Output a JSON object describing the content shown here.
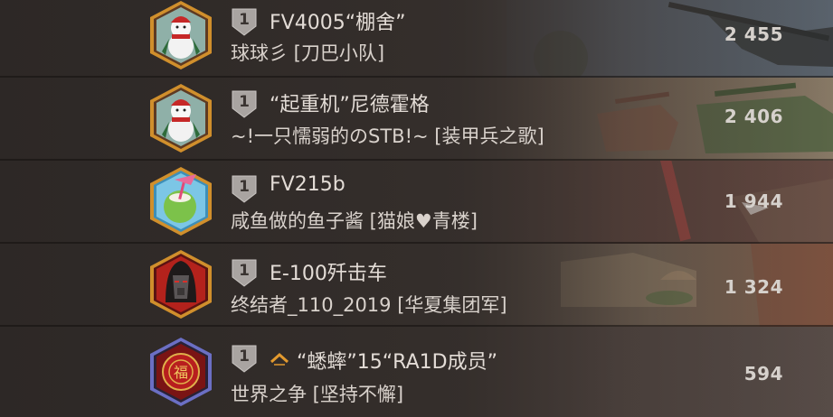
{
  "leaderboard": {
    "rows": [
      {
        "rank": "1",
        "name": "FV4005“棚舍”",
        "clan": "球球彡 [刀巴小队]",
        "score": "2 455",
        "avatar_icon": "snowman-avatar-icon",
        "accent": "#c98a2b"
      },
      {
        "rank": "1",
        "name": "“起重机”尼德霍格",
        "clan": "~!一只懦弱的のSTB!~ [装甲兵之歌]",
        "score": "2 406",
        "avatar_icon": "snowman-avatar-icon",
        "accent": "#c98a2b"
      },
      {
        "rank": "1",
        "name": "FV215b",
        "clan": "咸鱼做的鱼子酱 [猫娘♥青楼]",
        "score": "1 944",
        "avatar_icon": "coconut-drink-avatar-icon",
        "accent": "#c98a2b"
      },
      {
        "rank": "1",
        "name": "E-100歼击车",
        "clan": "终结者_110_2019 [华夏集团军]",
        "score": "1 324",
        "avatar_icon": "hooded-knight-avatar-icon",
        "accent": "#c98a2b"
      },
      {
        "rank": "1",
        "name": "“蟋蟀”15“RA1D成员”",
        "clan": "世界之争 [坚持不懈]",
        "score": "594",
        "avatar_icon": "fu-emblem-avatar-icon",
        "accent": "#6b6fc4",
        "has_rank_chevron": true
      }
    ]
  }
}
